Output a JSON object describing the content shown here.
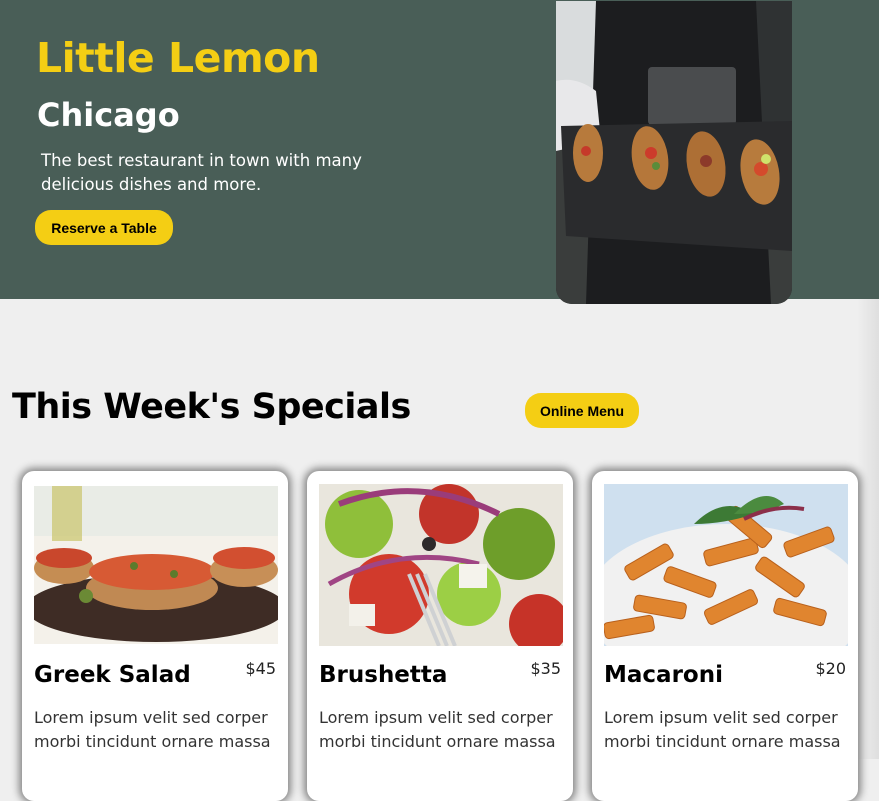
{
  "hero": {
    "brand": "Little Lemon",
    "city": "Chicago",
    "tagline": "The best restaurant in town with many delicious dishes and more.",
    "reserve_label": "Reserve a Table"
  },
  "specials": {
    "title": "This Week's Specials",
    "online_menu_label": "Online Menu",
    "cards": [
      {
        "name": "Greek Salad",
        "price": "$45",
        "description": "Lorem ipsum velit sed corper morbi tincidunt ornare massa"
      },
      {
        "name": "Brushetta",
        "price": "$35",
        "description": "Lorem ipsum velit sed corper morbi tincidunt ornare massa"
      },
      {
        "name": "Macaroni",
        "price": "$20",
        "description": "Lorem ipsum velit sed corper morbi tincidunt ornare massa"
      }
    ]
  },
  "colors": {
    "primary_green": "#495e57",
    "primary_yellow": "#f4ce14",
    "background": "#efefef"
  },
  "images": [
    "hero-chef-holding-bruschetta-tray",
    "bruschetta-dish-photo",
    "greek-salad-photo",
    "penne-pasta-photo"
  ]
}
